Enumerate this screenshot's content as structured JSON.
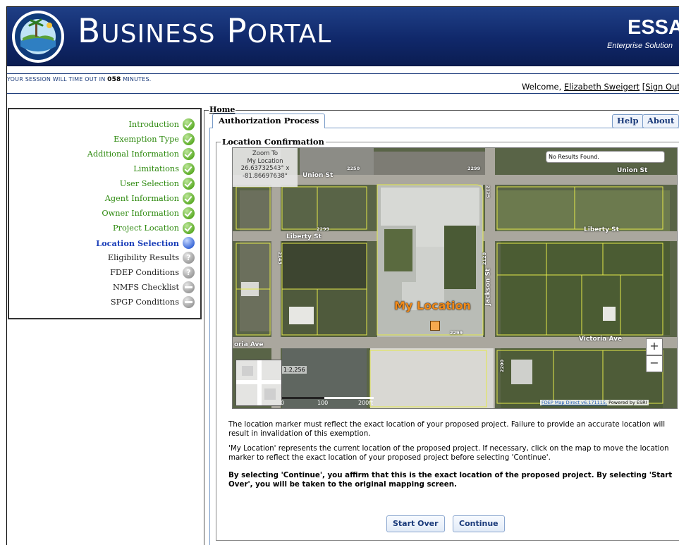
{
  "header": {
    "title": "Business Portal",
    "title_first_letter_1": "B",
    "title_rest_1": "USINESS",
    "title_first_letter_2": "P",
    "title_rest_2": "ORTAL",
    "brand": "ESSA",
    "brand_sub": "Enterprise Solution"
  },
  "session": {
    "prefix": "Your Session will time out in",
    "minutes": "058",
    "suffix": "minutes.",
    "welcome_prefix": "Welcome,",
    "user_name": "Elizabeth Sweigert",
    "sign_out": "[Sign Out"
  },
  "sidebar": {
    "items": [
      {
        "label": "Introduction",
        "status": "done"
      },
      {
        "label": "Exemption Type",
        "status": "done"
      },
      {
        "label": "Additional Information",
        "status": "done"
      },
      {
        "label": "Limitations",
        "status": "done"
      },
      {
        "label": "User Selection",
        "status": "done"
      },
      {
        "label": "Agent Information",
        "status": "done"
      },
      {
        "label": "Owner Information",
        "status": "done"
      },
      {
        "label": "Project Location",
        "status": "done"
      },
      {
        "label": "Location Selection",
        "status": "current"
      },
      {
        "label": "Eligibility Results",
        "status": "pending-question"
      },
      {
        "label": "FDEP Conditions",
        "status": "pending-question"
      },
      {
        "label": "NMFS Checklist",
        "status": "pending-dash"
      },
      {
        "label": "SPGP Conditions",
        "status": "pending-dash"
      }
    ]
  },
  "main": {
    "home_label": "Home",
    "tab_label": "Authorization Process",
    "help_label": "Help",
    "about_label": "About",
    "section_title": "Location Confirmation"
  },
  "map": {
    "zoom_to_l1": "Zoom To",
    "zoom_to_l2": "My Location",
    "zoom_to_l3": "26.63732543° x",
    "zoom_to_l4": "-81.86697638°",
    "search_status": "No Results Found.",
    "marker_label": "My Location",
    "zoom_in": "+",
    "zoom_out": "−",
    "scale_ratio": "1:2,256",
    "scale_0": "0",
    "scale_100": "100",
    "scale_200": "200ft",
    "credit_link": "FDEP Map Direct v6.171115,",
    "credit_text": " Powered by ESRI",
    "streets": {
      "union_left": "Union St",
      "union_right": "Union St",
      "liberty_left": "Liberty St",
      "liberty_right": "Liberty St",
      "victoria_left": "oria Ave",
      "victoria_right": "Victoria Ave",
      "jackson": "Jackson St"
    },
    "addresses": {
      "a1": "2250",
      "a2": "2299",
      "a3": "2299",
      "a4": "2299",
      "a5": "2120",
      "a6": "2125",
      "a7": "2200",
      "a8": "2143"
    }
  },
  "content": {
    "para1": "The location marker must reflect the exact location of your proposed project. Failure to provide an accurate location will result in invalidation of this exemption.",
    "para2": "'My Location' represents the current location of the proposed project. If necessary, click on the map to move the location marker to reflect the exact location of your proposed project before selecting 'Continue'.",
    "para3": "By selecting 'Continue', you affirm that this is the exact location of the proposed project. By selecting 'Start Over', you will be taken to the original mapping screen."
  },
  "buttons": {
    "start_over": "Start Over",
    "continue": "Continue"
  },
  "colors": {
    "banner": "#10286a",
    "done": "#2e8a0f",
    "current": "#1b3fb9",
    "marker": "#f08a1a"
  }
}
